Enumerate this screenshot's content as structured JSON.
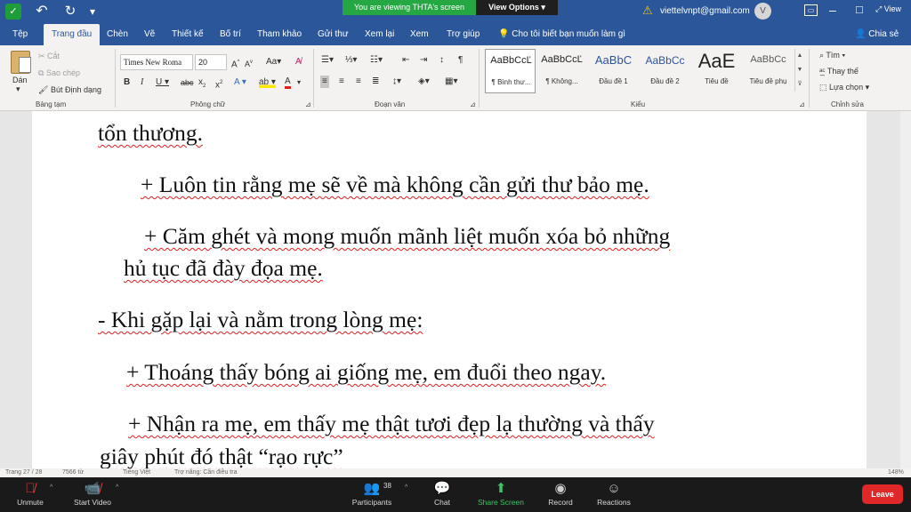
{
  "zoom": {
    "banner": "You are viewing THTA's screen",
    "view_options": "View Options",
    "participants_count": "38",
    "buttons": {
      "unmute": "Unmute",
      "start_video": "Start Video",
      "participants": "Participants",
      "chat": "Chat",
      "share_screen": "Share Screen",
      "record": "Record",
      "reactions": "Reactions",
      "leave": "Leave"
    },
    "accent": "#3ec467",
    "leave_color": "#e02828"
  },
  "titlebar": {
    "account": "viettelvnpt@gmail.com",
    "avatar_letter": "V",
    "view_label": "View",
    "color": "#2b579a"
  },
  "tabs": {
    "items": [
      "Tệp",
      "Trang đầu",
      "Chèn",
      "Vẽ",
      "Thiết kế",
      "Bố trí",
      "Tham khảo",
      "Gửi thư",
      "Xem lại",
      "Xem",
      "Trợ giúp"
    ],
    "active": "Trang đầu",
    "tell_me": "Cho tôi biết bạn muốn làm gì",
    "share": "Chia sẻ"
  },
  "ribbon": {
    "clipboard": {
      "paste": "Dán",
      "cut": "Cắt",
      "copy": "Sao chép",
      "format_painter": "Bút Định dạng",
      "label": "Bảng tạm"
    },
    "font": {
      "name": "Times New Roma",
      "size": "20",
      "label": "Phông chữ"
    },
    "paragraph": {
      "label": "Đoạn văn"
    },
    "styles": {
      "label": "Kiểu",
      "items": [
        {
          "sample": "AaBbCcĽ",
          "name": "¶ Bình thư..."
        },
        {
          "sample": "AaBbCcĽ",
          "name": "¶ Không..."
        },
        {
          "sample": "AaBbC",
          "name": "Đầu đề 1"
        },
        {
          "sample": "AaBbCc",
          "name": "Đầu đề 2"
        },
        {
          "sample": "AaE",
          "name": "Tiêu đề"
        },
        {
          "sample": "AaBbCc",
          "name": "Tiêu đề phụ"
        }
      ]
    },
    "editing": {
      "find": "Tìm",
      "replace": "Thay thế",
      "select": "Lựa chọn",
      "label": "Chỉnh sửa"
    }
  },
  "document": {
    "lines": [
      "tổn thương.",
      "+ Luôn tin rằng mẹ sẽ về mà không cần gửi thư bảo mẹ.",
      "+ Căm ghét và mong muốn mãnh liệt muốn xóa bỏ những",
      "hủ tục đã đày đọa mẹ.",
      "- Khi gặp lại và nằm trong lòng mẹ:",
      "+ Thoáng thấy bóng ai giống mẹ, em đuổi theo ngay.",
      "+ Nhận ra mẹ, em thấy mẹ thật tươi đẹp lạ thường và thấy",
      "giây phút đó thật “rạo rực”"
    ]
  },
  "statusbar": {
    "page": "Trang 27 / 28",
    "words": "7566 từ",
    "language": "Tiếng Việt",
    "accessibility": "Trợ năng: Cần điều tra",
    "zoom": "148%"
  }
}
